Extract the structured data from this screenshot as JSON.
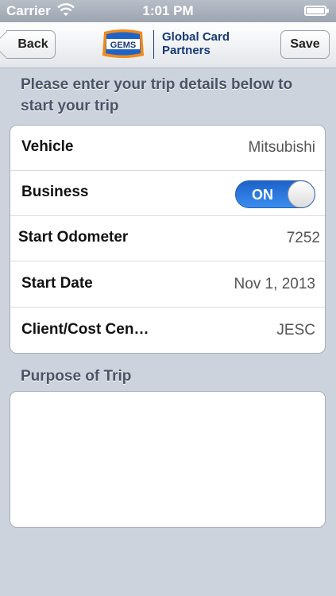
{
  "status_bar": {
    "carrier": "Carrier",
    "time": "1:01 PM"
  },
  "nav": {
    "back_label": "Back",
    "save_label": "Save",
    "logo_badge": "GEMS",
    "logo_line1": "Global Card",
    "logo_line2": "Partners"
  },
  "intro": "Please enter your trip details below to start your trip",
  "rows": [
    {
      "label": "Vehicle",
      "value": "Mitsubishi"
    },
    {
      "label": "Business",
      "toggle": "ON",
      "toggle_on": true
    },
    {
      "label": "Start Odometer",
      "value": "7252"
    },
    {
      "label": "Start Date",
      "value": "Nov 1, 2013"
    },
    {
      "label": "Client/Cost Cen…",
      "value": "JESC"
    }
  ],
  "purpose_label": "Purpose of Trip",
  "purpose_value": "",
  "colors": {
    "toggle_on": "#2f7ee6",
    "brand_blue": "#173a78",
    "brand_orange": "#f08a1c"
  }
}
